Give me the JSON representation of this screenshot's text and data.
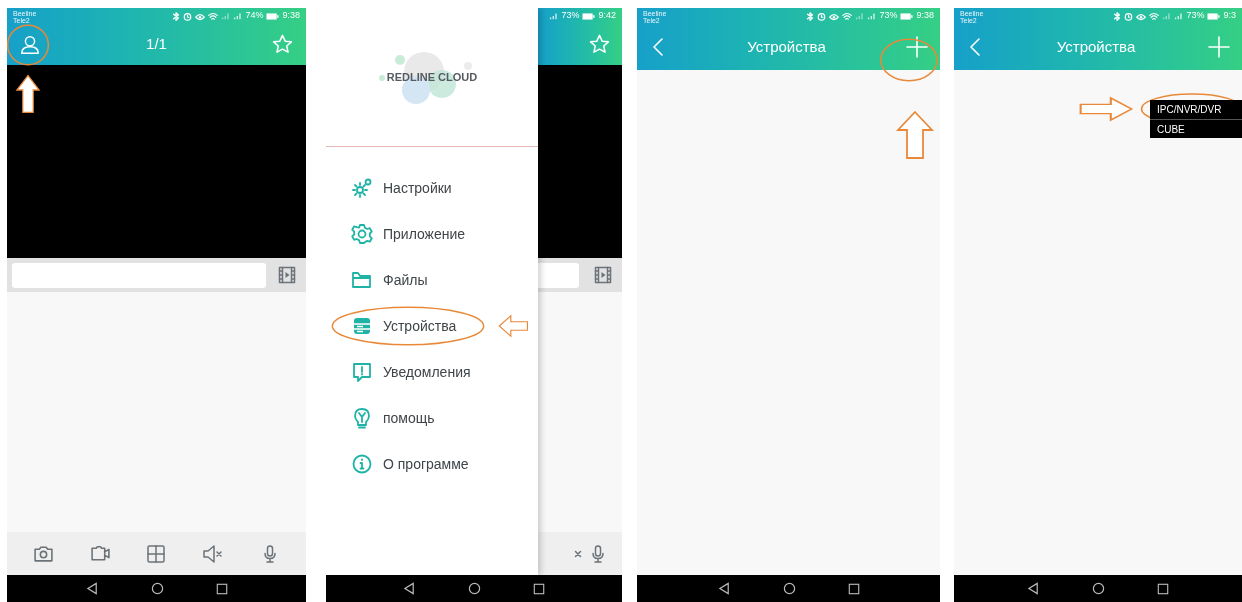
{
  "panels": [
    {
      "kind": "live_view",
      "status": {
        "carrier_1": "Beeline",
        "carrier_2": "Tele2",
        "battery": "74%",
        "time": "9:38"
      },
      "title": "1/1",
      "user_button_marked": true
    },
    {
      "kind": "drawer",
      "status": {
        "battery": "73%",
        "time": "9:42"
      },
      "logo": "REDLINE CLOUD",
      "menu": [
        {
          "label": "Настройки",
          "marked": false
        },
        {
          "label": "Приложение",
          "marked": false
        },
        {
          "label": "Файлы",
          "marked": false
        },
        {
          "label": "Устройства",
          "marked": true
        },
        {
          "label": "Уведомления",
          "marked": false
        },
        {
          "label": "помощь",
          "marked": false
        },
        {
          "label": "О программе",
          "marked": false
        }
      ]
    },
    {
      "kind": "devices",
      "status": {
        "carrier_1": "Beeline",
        "carrier_2": "Tele2",
        "battery": "73%",
        "time": "9:38"
      },
      "title": "Устройства",
      "add_button_marked": true
    },
    {
      "kind": "devices",
      "status": {
        "carrier_1": "Beeline",
        "carrier_2": "Tele2",
        "battery": "73%",
        "time": "9:3"
      },
      "title": "Устройства",
      "add_button_marked": false,
      "dropdown": [
        {
          "label": "IPC/NVR/DVR",
          "marked": true
        },
        {
          "label": "CUBE",
          "marked": false
        }
      ]
    }
  ]
}
